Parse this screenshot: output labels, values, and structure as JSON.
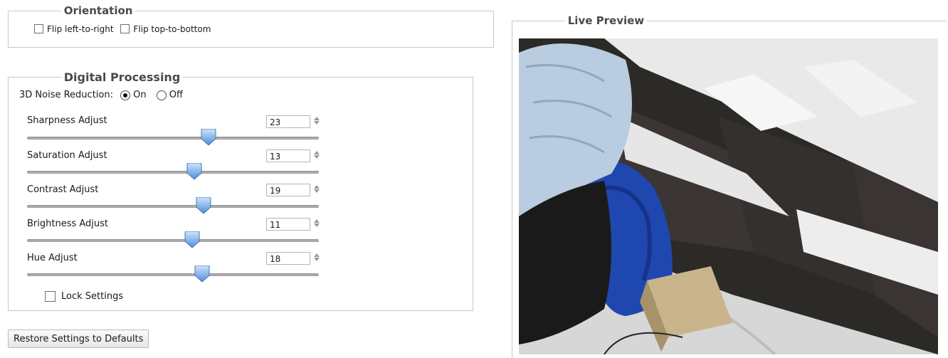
{
  "orientation": {
    "title": "Orientation",
    "flip_lr": {
      "label": "Flip left-to-right",
      "checked": false
    },
    "flip_tb": {
      "label": "Flip top-to-bottom",
      "checked": false
    }
  },
  "digital": {
    "title": "Digital Processing",
    "noise": {
      "label": "3D Noise Reduction:",
      "options": [
        {
          "label": "On",
          "selected": true
        },
        {
          "label": "Off",
          "selected": false
        }
      ]
    },
    "adjustments": [
      {
        "label": "Sharpness Adjust",
        "value": "23"
      },
      {
        "label": "Saturation Adjust",
        "value": "13"
      },
      {
        "label": "Contrast Adjust",
        "value": "19"
      },
      {
        "label": "Brightness Adjust",
        "value": "11"
      },
      {
        "label": "Hue Adjust",
        "value": "18"
      }
    ],
    "lock": {
      "label": "Lock Settings",
      "checked": false
    }
  },
  "restore_label": "Restore Settings to Defaults",
  "preview": {
    "title": "Live Preview"
  },
  "colors": {
    "slider_thumb": "#5b9be0",
    "border": "#c8c8c8",
    "legend_text": "#4a4a4a"
  }
}
